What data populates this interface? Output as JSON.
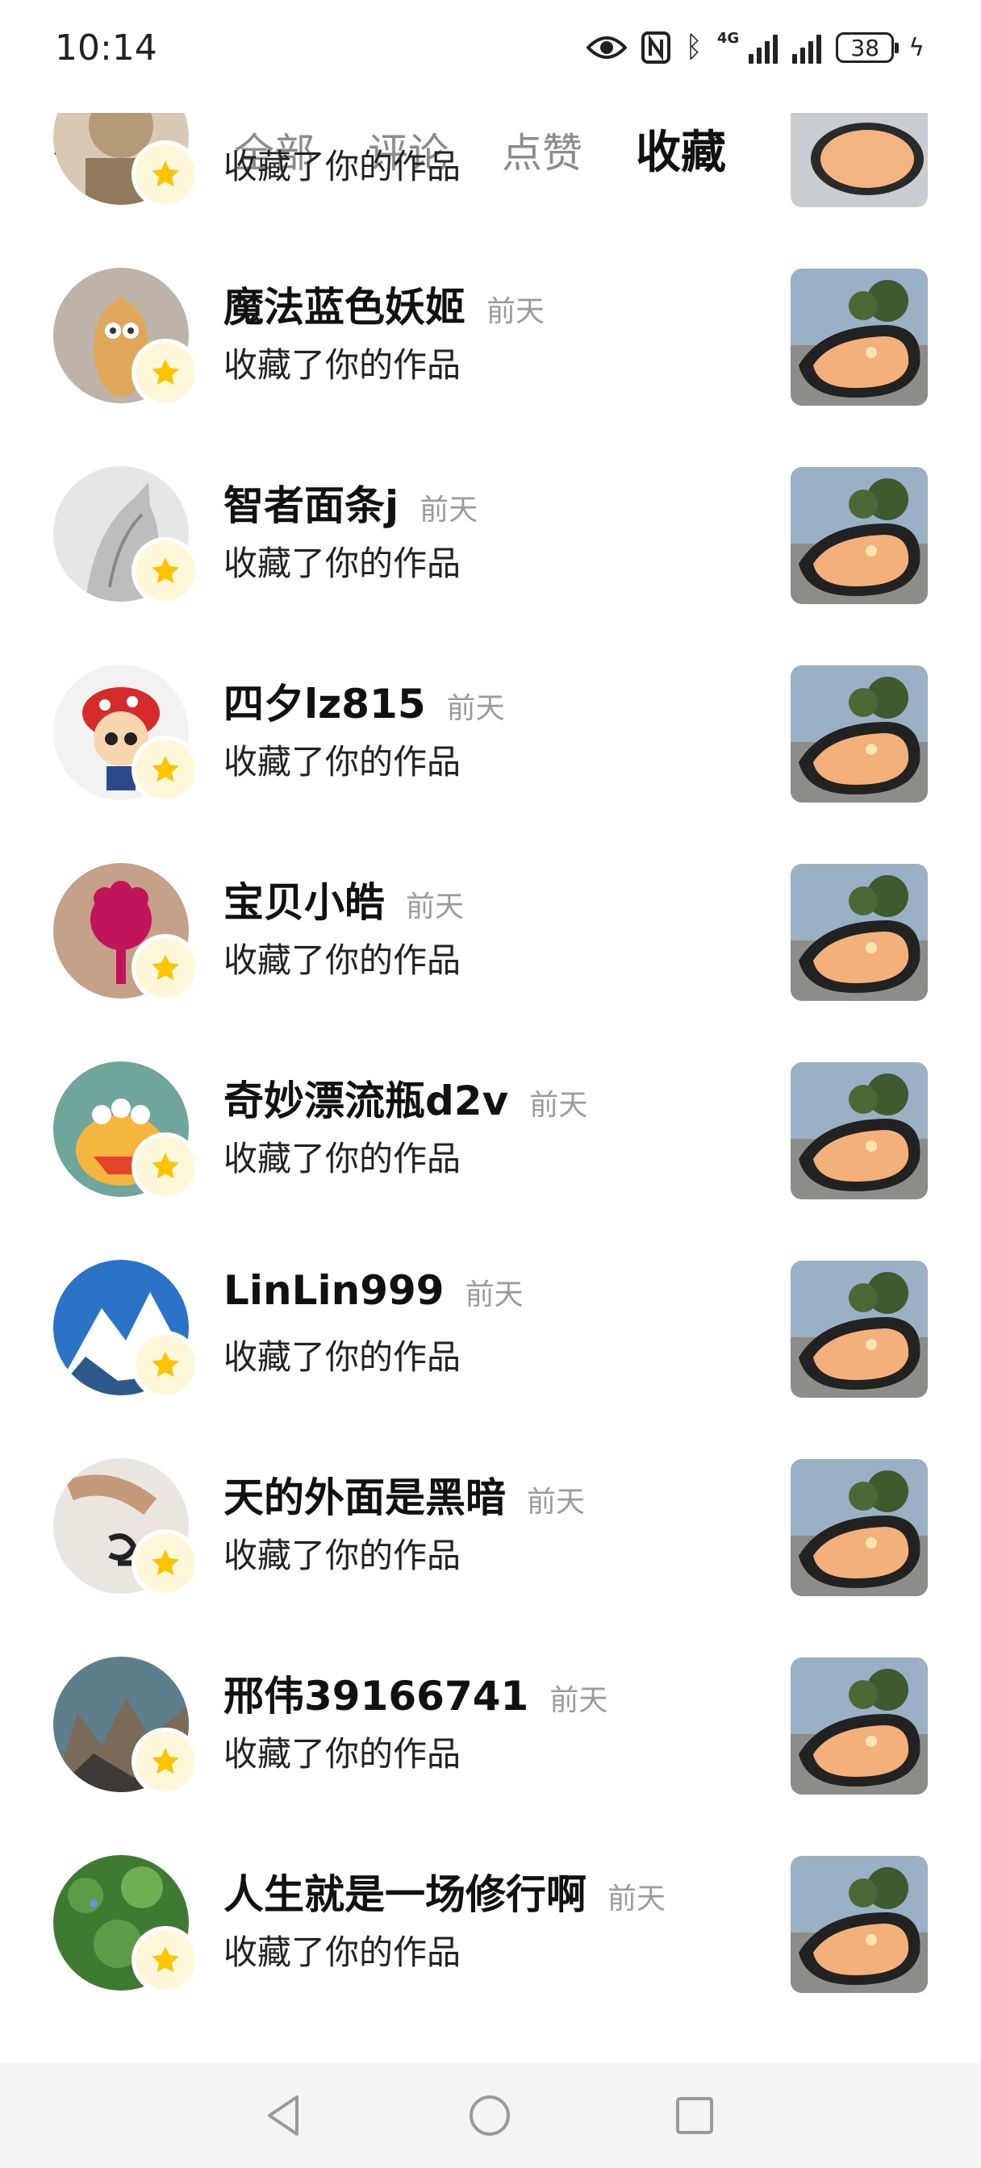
{
  "status_bar": {
    "time": "10:14",
    "network": "4G",
    "battery": "38"
  },
  "header": {
    "back_icon": "chevron-left-icon",
    "tabs": [
      {
        "label": "全部",
        "active": false
      },
      {
        "label": "评论",
        "active": false
      },
      {
        "label": "点赞",
        "active": false
      },
      {
        "label": "收藏",
        "active": true
      }
    ]
  },
  "notifications": {
    "partial_top": {
      "action": "收藏了你的作品"
    },
    "items": [
      {
        "name": "魔法蓝色妖姬",
        "time": "前天",
        "action": "收藏了你的作品"
      },
      {
        "name": "智者面条j",
        "time": "前天",
        "action": "收藏了你的作品"
      },
      {
        "name": "四夕lz815",
        "time": "前天",
        "action": "收藏了你的作品"
      },
      {
        "name": "宝贝小皓",
        "time": "前天",
        "action": "收藏了你的作品"
      },
      {
        "name": "奇妙漂流瓶d2v",
        "time": "前天",
        "action": "收藏了你的作品"
      },
      {
        "name": "LinLin999",
        "time": "前天",
        "action": "收藏了你的作品"
      },
      {
        "name": "天的外面是黑暗",
        "time": "前天",
        "action": "收藏了你的作品"
      },
      {
        "name": "邢伟39166741",
        "time": "前天",
        "action": "收藏了你的作品"
      },
      {
        "name": "人生就是一场修行啊",
        "time": "前天",
        "action": "收藏了你的作品"
      }
    ]
  },
  "colors": {
    "star": "#ffc400",
    "badge_bg": "#fff7da",
    "active_tab": "#111111",
    "inactive_tab": "#8c8c8c",
    "time_text": "#9b9b9b"
  },
  "navbar": {
    "icons": [
      "back-triangle-icon",
      "home-circle-icon",
      "recents-square-icon"
    ]
  }
}
